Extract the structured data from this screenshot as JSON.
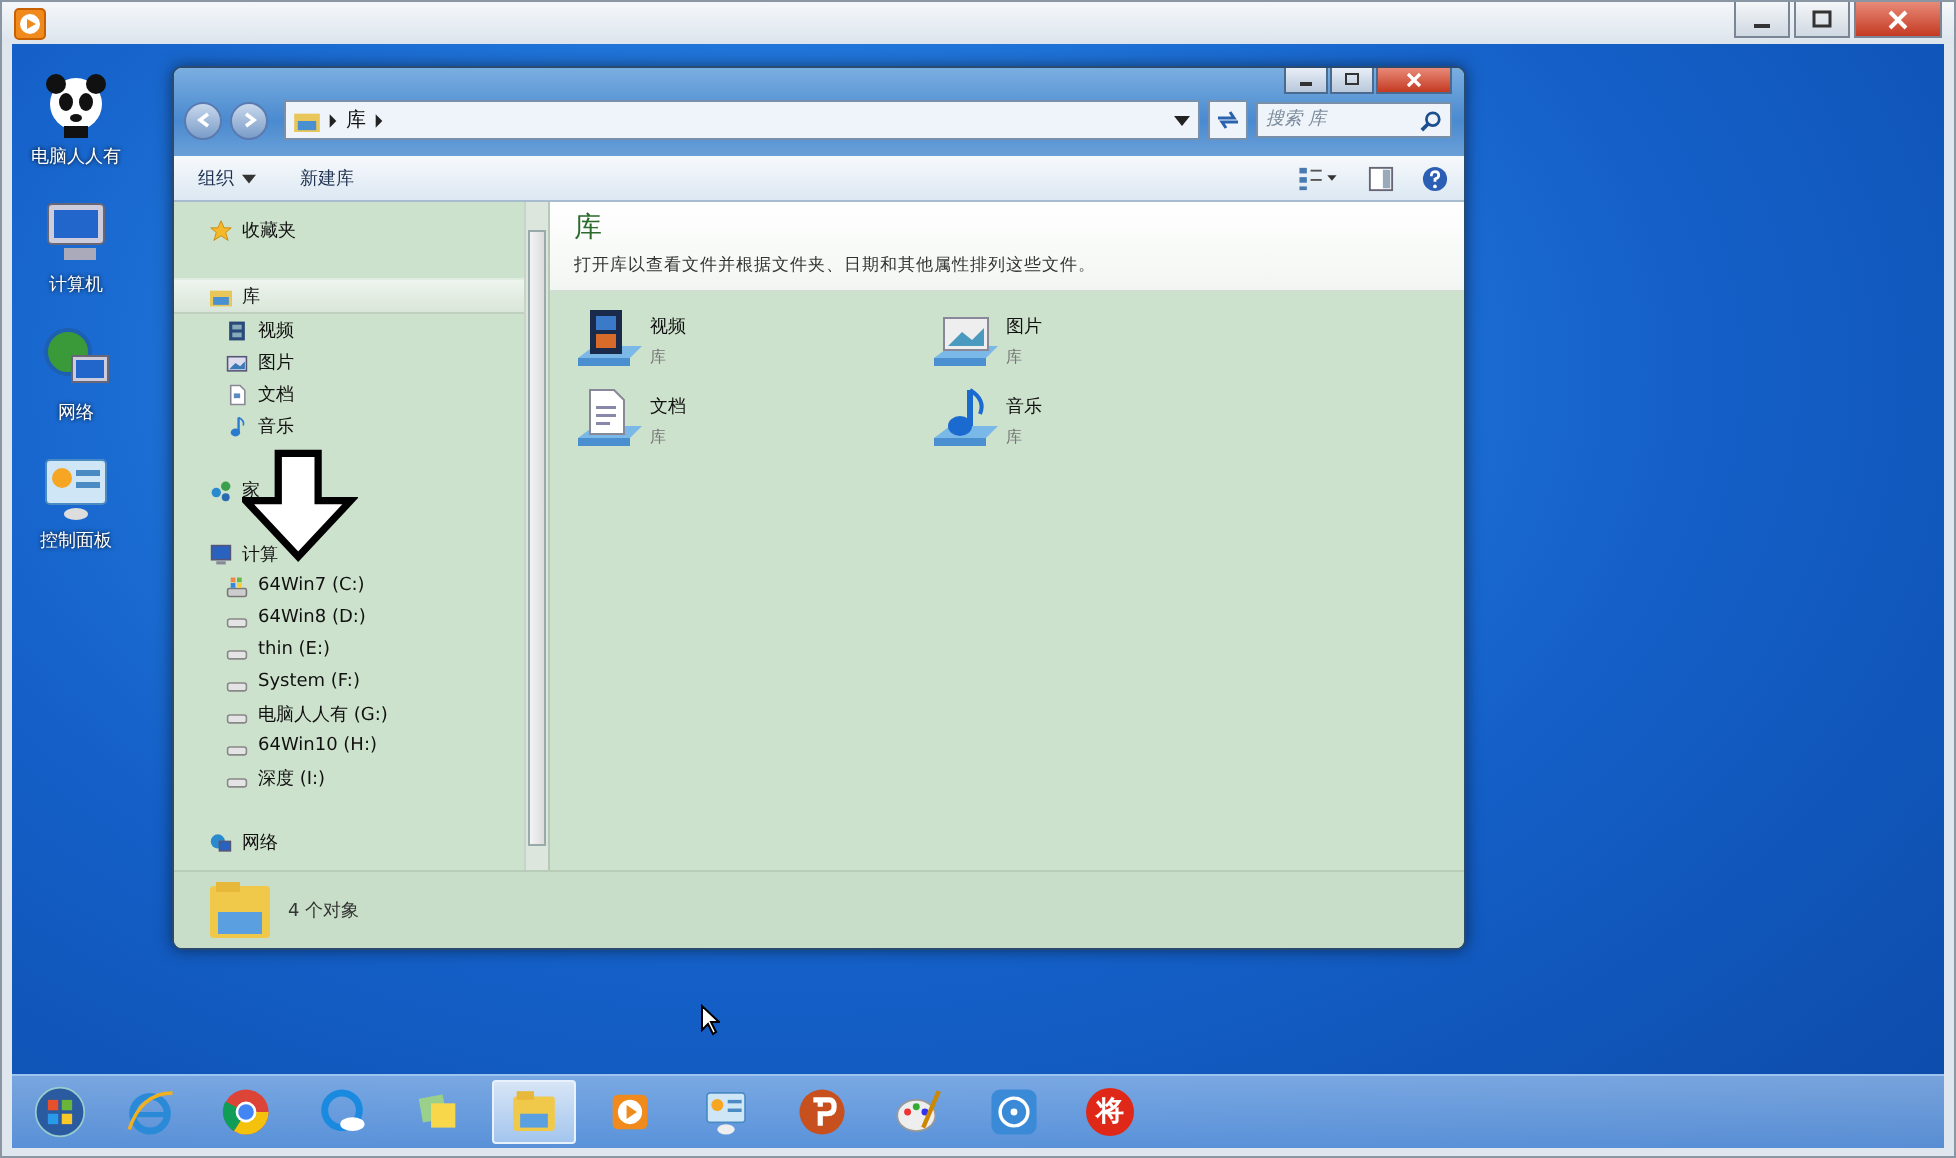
{
  "desktop_icons": [
    {
      "label": "电脑人人有",
      "kind": "panda"
    },
    {
      "label": "计算机",
      "kind": "computer"
    },
    {
      "label": "网络",
      "kind": "network"
    },
    {
      "label": "控制面板",
      "kind": "control-panel"
    }
  ],
  "explorer": {
    "address": [
      "库"
    ],
    "search": {
      "placeholder": "搜索 库"
    },
    "toolbar": [
      {
        "label": "组织",
        "dropdown": true
      },
      {
        "label": "新建库",
        "dropdown": false
      }
    ],
    "nav": [
      {
        "label": "收藏夹",
        "kind": "star",
        "selected": false
      },
      {
        "label": "库",
        "kind": "library",
        "selected": true,
        "children": [
          {
            "label": "视频",
            "kind": "video",
            "selected": false
          },
          {
            "label": "图片",
            "kind": "picture",
            "selected": false
          },
          {
            "label": "文档",
            "kind": "document",
            "selected": false
          },
          {
            "label": "音乐",
            "kind": "music",
            "selected": false
          }
        ]
      },
      {
        "label": "家",
        "kind": "homegroup",
        "selected": false
      },
      {
        "label": "计算",
        "kind": "computer",
        "selected": false,
        "children": [
          {
            "label": "64Win7  (C:)",
            "kind": "system-drive",
            "selected": false
          },
          {
            "label": "64Win8  (D:)",
            "kind": "drive",
            "selected": false
          },
          {
            "label": "thin (E:)",
            "kind": "drive",
            "selected": false
          },
          {
            "label": "System (F:)",
            "kind": "drive",
            "selected": false
          },
          {
            "label": "电脑人人有 (G:)",
            "kind": "drive",
            "selected": false
          },
          {
            "label": "64Win10 (H:)",
            "kind": "drive",
            "selected": false
          },
          {
            "label": "深度 (I:)",
            "kind": "drive",
            "selected": false
          }
        ]
      },
      {
        "label": "网络",
        "kind": "network",
        "selected": false
      }
    ],
    "content": {
      "heading": "库",
      "description": "打开库以查看文件并根据文件夹、日期和其他属性排列这些文件。",
      "libraries": [
        {
          "name": "视频",
          "type": "库",
          "kind": "video"
        },
        {
          "name": "图片",
          "type": "库",
          "kind": "picture"
        },
        {
          "name": "文档",
          "type": "库",
          "kind": "document"
        },
        {
          "name": "音乐",
          "type": "库",
          "kind": "music"
        }
      ]
    },
    "status": {
      "count": "4 个对象"
    }
  },
  "annotation": {
    "kind": "down-arrow"
  },
  "taskbar": {
    "apps": [
      {
        "kind": "start",
        "selected": false
      },
      {
        "kind": "ie",
        "selected": false
      },
      {
        "kind": "chrome",
        "selected": false
      },
      {
        "kind": "cloud",
        "selected": false
      },
      {
        "kind": "notes",
        "selected": false
      },
      {
        "kind": "explorer",
        "selected": true
      },
      {
        "kind": "player",
        "selected": false
      },
      {
        "kind": "control-panel",
        "selected": false
      },
      {
        "kind": "p-app",
        "selected": false
      },
      {
        "kind": "paint",
        "selected": false
      },
      {
        "kind": "video",
        "selected": false
      },
      {
        "kind": "chess",
        "selected": false,
        "label": "将"
      }
    ]
  }
}
